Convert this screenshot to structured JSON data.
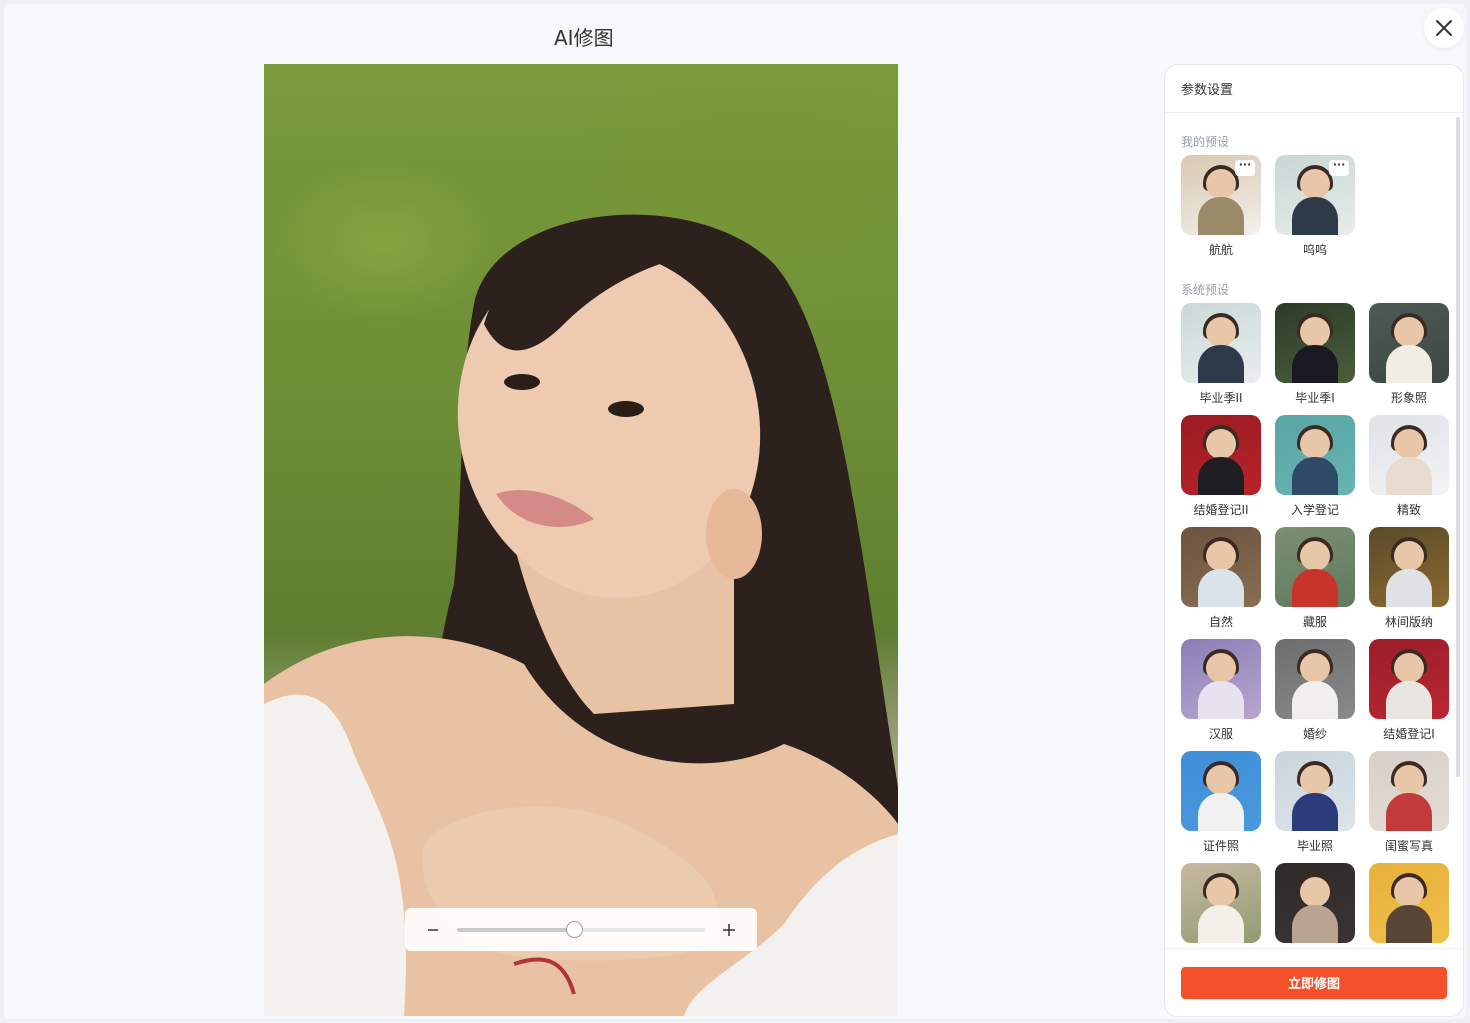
{
  "window": {
    "title": "AI修图"
  },
  "zoom": {
    "level": 0.47,
    "minus_label": "−",
    "plus_label": "+"
  },
  "panel": {
    "header": "参数设置",
    "my_presets_label": "我的预设",
    "my_presets": [
      {
        "label": "航航",
        "colors": [
          "#d9c7b2",
          "#9a8a6a",
          "#f2f0ec"
        ]
      },
      {
        "label": "呜呜",
        "colors": [
          "#c8d6d4",
          "#2f3a48",
          "#e9ece9"
        ]
      }
    ],
    "system_presets_label": "系统预设",
    "system_presets": [
      {
        "label": "毕业季II",
        "colors": [
          "#c9d8d6",
          "#2e3a4a",
          "#eaeef0"
        ]
      },
      {
        "label": "毕业季I",
        "colors": [
          "#2b3b2a",
          "#1a1a22",
          "#4d5d3a"
        ]
      },
      {
        "label": "形象照",
        "colors": [
          "#4e5a55",
          "#f1ede6",
          "#3c4743"
        ]
      },
      {
        "label": "结婚登记II",
        "colors": [
          "#9b1b22",
          "#1d1d22",
          "#b8232b"
        ]
      },
      {
        "label": "入学登记",
        "colors": [
          "#5aa6a4",
          "#2f4a66",
          "#67b3b1"
        ]
      },
      {
        "label": "精致",
        "colors": [
          "#dfe3e6",
          "#e8dcd0",
          "#f2f3f5"
        ]
      },
      {
        "label": "自然",
        "colors": [
          "#6b5440",
          "#d8e3ea",
          "#8a6d52"
        ]
      },
      {
        "label": "藏服",
        "colors": [
          "#7c8f74",
          "#c8332a",
          "#5f7a5c"
        ]
      },
      {
        "label": "林间版纳",
        "colors": [
          "#5b4a2a",
          "#dfe2e4",
          "#8a6b32"
        ]
      },
      {
        "label": "汉服",
        "colors": [
          "#8a7fb8",
          "#e7e2f0",
          "#b8a6cf"
        ]
      },
      {
        "label": "婚纱",
        "colors": [
          "#6d6d6d",
          "#f0efee",
          "#8a8a8a"
        ]
      },
      {
        "label": "结婚登记I",
        "colors": [
          "#9a1e28",
          "#e9e6e2",
          "#b92732"
        ]
      },
      {
        "label": "证件照",
        "colors": [
          "#3f8fd8",
          "#f1f1f1",
          "#4a99de"
        ]
      },
      {
        "label": "毕业照",
        "colors": [
          "#c9d4dc",
          "#2a3d7a",
          "#dde4ea"
        ]
      },
      {
        "label": "闺蜜写真",
        "colors": [
          "#d6d0c9",
          "#c23a3a",
          "#e3ddd6"
        ]
      },
      {
        "label": "",
        "colors": [
          "#c9b9a2",
          "#f3f0ea",
          "#8f9c72"
        ]
      },
      {
        "label": "",
        "colors": [
          "#2d2a28",
          "#b9a493",
          "#3a3532"
        ]
      },
      {
        "label": "",
        "colors": [
          "#e7b03a",
          "#5a4636",
          "#efc04b"
        ]
      }
    ],
    "submit_label": "立即修图"
  }
}
